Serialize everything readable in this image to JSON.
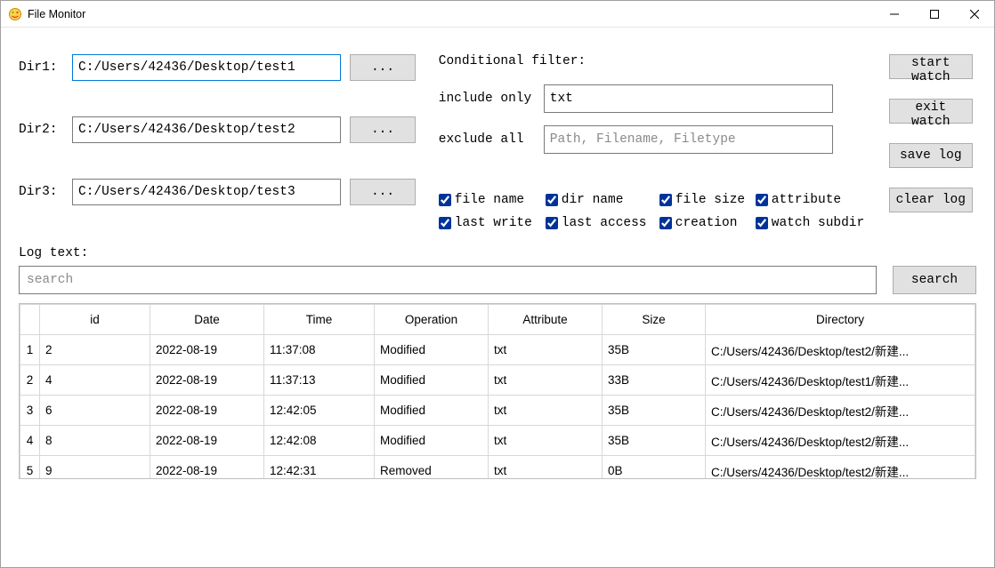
{
  "window": {
    "title": "File Monitor"
  },
  "dirs": {
    "label1": "Dir1:",
    "value1": "C:/Users/42436/Desktop/test1",
    "label2": "Dir2:",
    "value2": "C:/Users/42436/Desktop/test2",
    "label3": "Dir3:",
    "value3": "C:/Users/42436/Desktop/test3",
    "browse_label": "..."
  },
  "filter": {
    "title": "Conditional filter:",
    "include_label": "include only",
    "include_value": "txt",
    "exclude_label": "exclude  all",
    "exclude_placeholder": "Path, Filename, Filetype"
  },
  "checks": {
    "file_name": "file name",
    "dir_name": "dir name",
    "file_size": "file size",
    "attribute": "attribute",
    "last_write": "last write",
    "last_access": "last access",
    "creation": "creation",
    "watch_subdir": "watch subdir"
  },
  "actions": {
    "start_watch": "start watch",
    "exit_watch": "exit watch",
    "save_log": "save log",
    "clear_log": "clear log"
  },
  "log": {
    "label": "Log text:",
    "search_placeholder": "search",
    "search_button": "search"
  },
  "table": {
    "headers": {
      "id": "id",
      "date": "Date",
      "time": "Time",
      "operation": "Operation",
      "attribute": "Attribute",
      "size": "Size",
      "directory": "Directory"
    },
    "rows": [
      {
        "rn": "1",
        "id": "2",
        "date": "2022-08-19",
        "time": "11:37:08",
        "op": "Modified",
        "attr": "txt",
        "size": "35B",
        "dir": "C:/Users/42436/Desktop/test2/新建..."
      },
      {
        "rn": "2",
        "id": "4",
        "date": "2022-08-19",
        "time": "11:37:13",
        "op": "Modified",
        "attr": "txt",
        "size": "33B",
        "dir": "C:/Users/42436/Desktop/test1/新建..."
      },
      {
        "rn": "3",
        "id": "6",
        "date": "2022-08-19",
        "time": "12:42:05",
        "op": "Modified",
        "attr": "txt",
        "size": "35B",
        "dir": "C:/Users/42436/Desktop/test2/新建..."
      },
      {
        "rn": "4",
        "id": "8",
        "date": "2022-08-19",
        "time": "12:42:08",
        "op": "Modified",
        "attr": "txt",
        "size": "35B",
        "dir": "C:/Users/42436/Desktop/test2/新建..."
      },
      {
        "rn": "5",
        "id": "9",
        "date": "2022-08-19",
        "time": "12:42:31",
        "op": "Removed",
        "attr": "txt",
        "size": "0B",
        "dir": "C:/Users/42436/Desktop/test2/新建..."
      }
    ]
  }
}
